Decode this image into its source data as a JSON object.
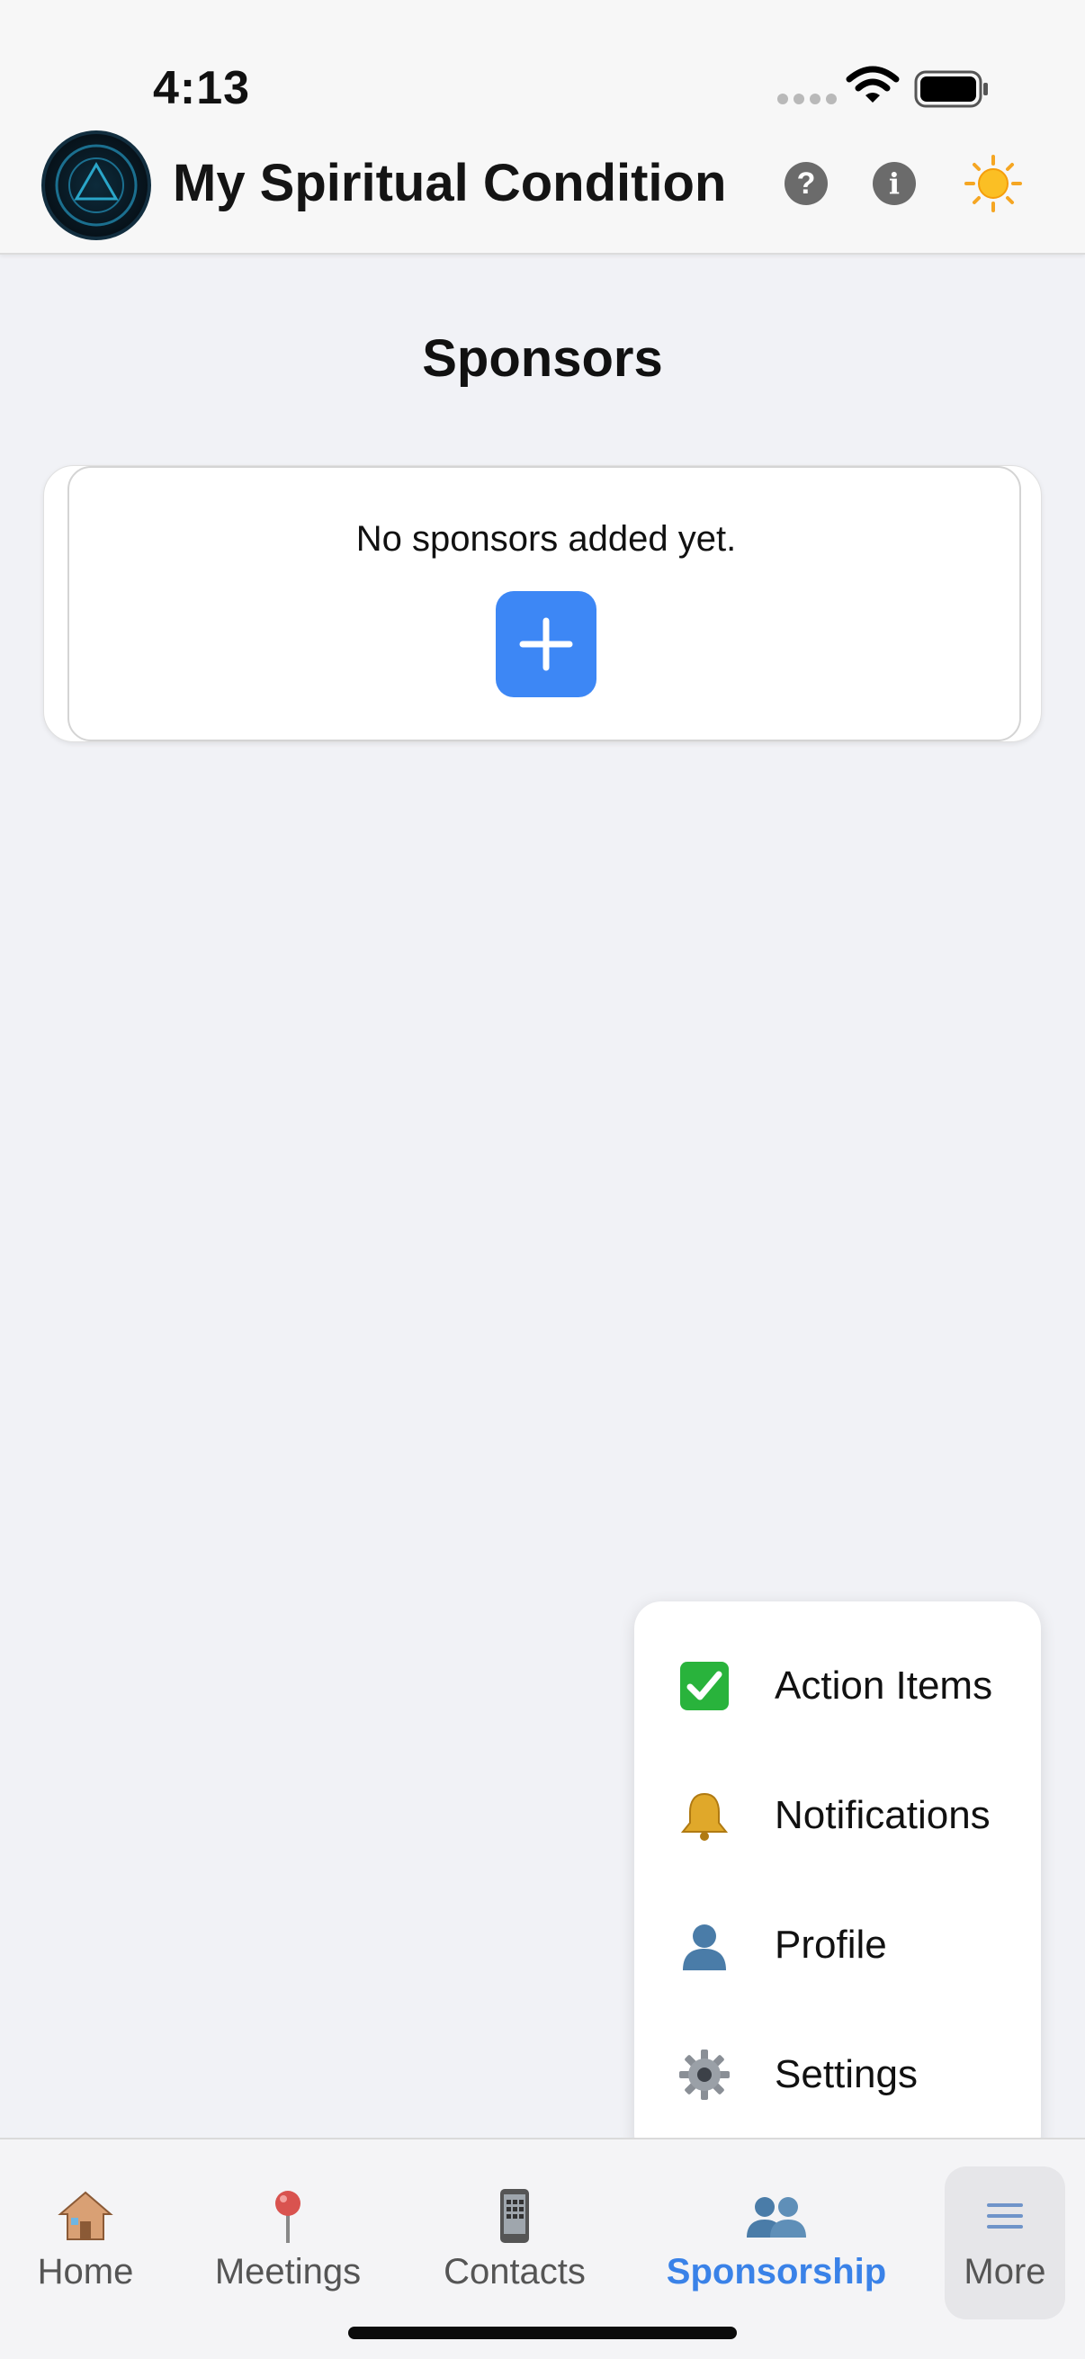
{
  "status": {
    "time": "4:13"
  },
  "header": {
    "title": "My Spiritual Condition",
    "help_label": "?",
    "info_label": "i"
  },
  "main": {
    "title": "Sponsors",
    "empty_message": "No sponsors added yet."
  },
  "menu": {
    "items": [
      {
        "label": "Action Items",
        "icon": "check-box-icon"
      },
      {
        "label": "Notifications",
        "icon": "bell-icon"
      },
      {
        "label": "Profile",
        "icon": "person-icon"
      },
      {
        "label": "Settings",
        "icon": "gear-icon"
      }
    ]
  },
  "tabs": [
    {
      "label": "Home",
      "icon": "house-icon"
    },
    {
      "label": "Meetings",
      "icon": "pushpin-icon"
    },
    {
      "label": "Contacts",
      "icon": "phone-icon"
    },
    {
      "label": "Sponsorship",
      "icon": "people-icon",
      "active": true
    },
    {
      "label": "More",
      "icon": "menu-icon"
    }
  ],
  "colors": {
    "accent": "#3d87f5",
    "active_tab": "#3a82e8",
    "background": "#f1f2f6"
  }
}
